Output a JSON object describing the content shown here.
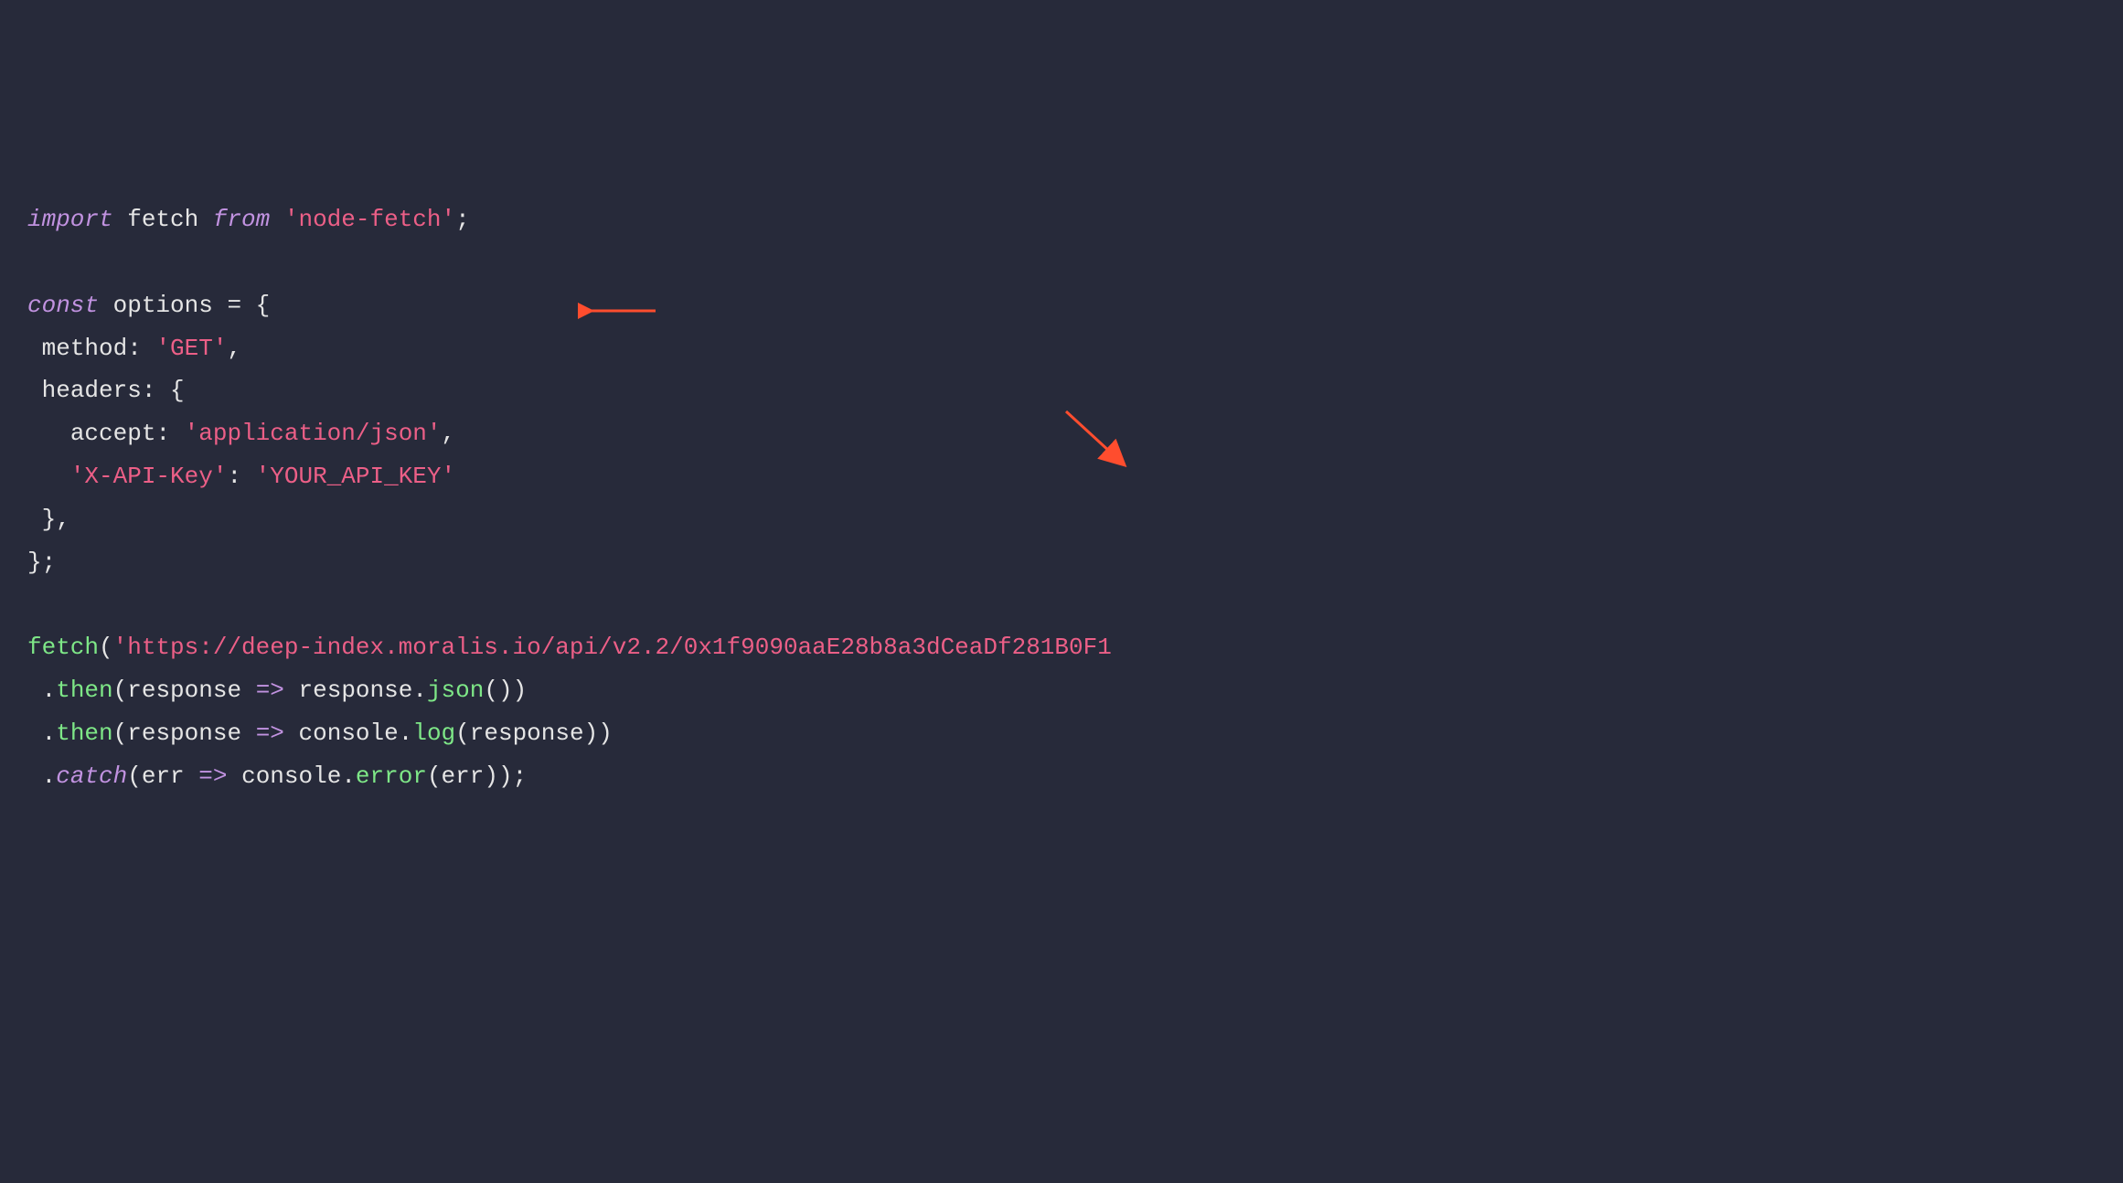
{
  "code": {
    "line1": {
      "kw_import": "import",
      "ident_fetch": " fetch ",
      "kw_from": "from",
      "space": " ",
      "string_module": "'node-fetch'",
      "semi": ";"
    },
    "line3": {
      "kw_const": "const",
      "ident": " options ",
      "eq": "=",
      "brace": " {"
    },
    "line4": {
      "indent": " ",
      "key": "method",
      "colon": ": ",
      "value": "'GET'",
      "comma": ","
    },
    "line5": {
      "indent": " ",
      "key": "headers",
      "colon": ": ",
      "brace": "{"
    },
    "line6": {
      "indent": "   ",
      "key": "accept",
      "colon": ": ",
      "value": "'application/json'",
      "comma": ","
    },
    "line7": {
      "indent": "   ",
      "key": "'X-API-Key'",
      "colon": ": ",
      "value": "'YOUR_API_KEY'"
    },
    "line8": {
      "indent": " ",
      "brace": "}",
      "comma": ","
    },
    "line9": {
      "brace": "}",
      "semi": ";"
    },
    "line11": {
      "func": "fetch",
      "paren_open": "(",
      "url": "'https://deep-index.moralis.io/api/v2.2/0x1f9090aaE28b8a3dCeaDf281B0F1",
      "trail": ""
    },
    "line12": {
      "indent": " ",
      "dot": ".",
      "method": "then",
      "paren_open": "(",
      "param": "response ",
      "arrow": "=>",
      "space": " ",
      "obj": "response",
      "dot2": ".",
      "call": "json",
      "parens": "()",
      "paren_close": ")"
    },
    "line13": {
      "indent": " ",
      "dot": ".",
      "method": "then",
      "paren_open": "(",
      "param": "response ",
      "arrow": "=>",
      "space": " ",
      "obj": "console",
      "dot2": ".",
      "call": "log",
      "paren2_open": "(",
      "arg": "response",
      "paren2_close": ")",
      "paren_close": ")"
    },
    "line14": {
      "indent": " ",
      "dot": ".",
      "method": "catch",
      "paren_open": "(",
      "param": "err ",
      "arrow": "=>",
      "space": " ",
      "obj": "console",
      "dot2": ".",
      "call": "error",
      "paren2_open": "(",
      "arg": "err",
      "paren2_close": ")",
      "paren_close": ")",
      "semi": ";"
    }
  },
  "annotations": {
    "arrow1_target": "YOUR_API_KEY",
    "arrow2_target": "url-endpoint"
  }
}
